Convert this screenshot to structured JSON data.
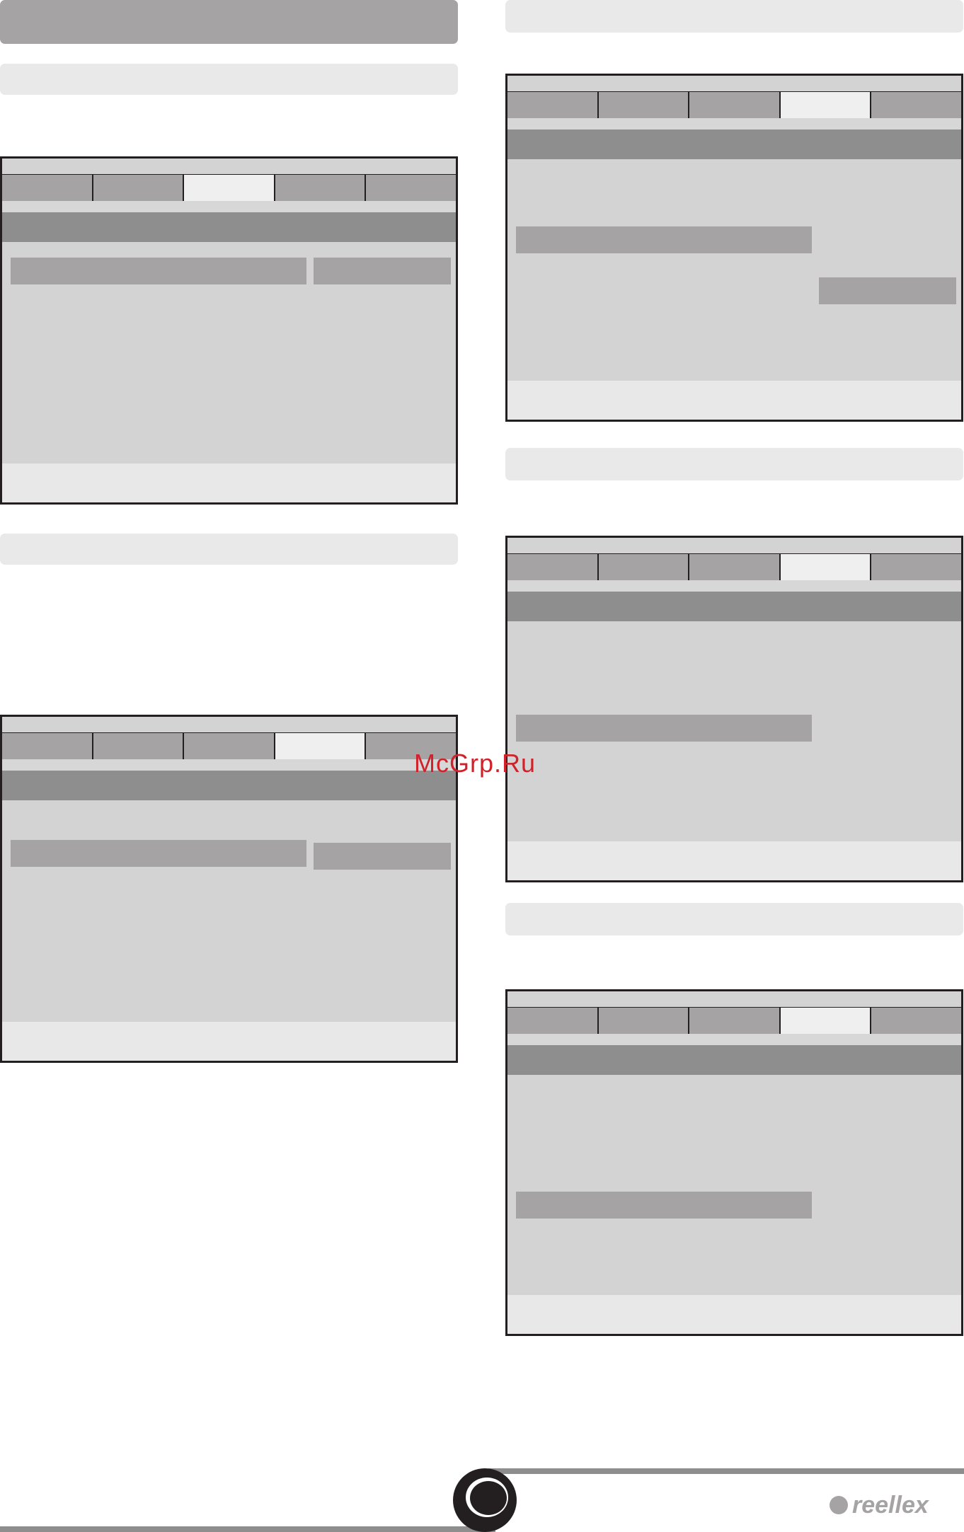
{
  "watermark": "McGrp.Ru",
  "brand": "reellex",
  "colors": {
    "dark_bar": "#a5a3a4",
    "light_bar": "#e9e9e9",
    "menu_heading": "#8f8e8f",
    "menu_body": "#d3d3d3",
    "active_tab": "#efefef",
    "border": "#231f20",
    "watermark": "#d0222b"
  },
  "screens": [
    {
      "active_tab": 3
    },
    {
      "active_tab": 4
    },
    {
      "active_tab": 4
    },
    {
      "active_tab": 4
    },
    {
      "active_tab": 4
    }
  ],
  "icons": [
    "reellex-logo-icon"
  ]
}
